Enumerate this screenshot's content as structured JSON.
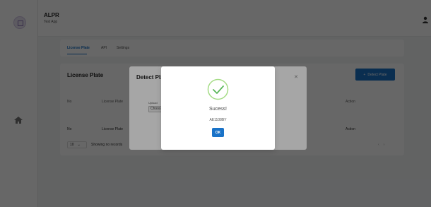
{
  "app": {
    "title": "ALPR",
    "subtitle": "Test App"
  },
  "tabs": [
    {
      "label": "License Plate",
      "active": true
    },
    {
      "label": "API",
      "active": false
    },
    {
      "label": "Settings",
      "active": false
    }
  ],
  "card": {
    "title": "License Plate",
    "detect_button": "Detect Plate",
    "headers": [
      "No",
      "License Plate",
      "Action"
    ],
    "footer": [
      "No",
      "License Plate",
      "Action"
    ],
    "page_size": "10",
    "records_text": "Showing no records"
  },
  "detect_modal": {
    "title": "Detect Plat",
    "upload_label": "Upload",
    "choose_button": "Choos"
  },
  "alert": {
    "title": "Sucess!",
    "plate": "AE1108BY",
    "ok_label": "OK"
  },
  "colors": {
    "primary": "#1a73c8",
    "success": "#5cb85c"
  },
  "icons": {
    "logo": "chip-logo-icon",
    "home": "home-icon",
    "user": "user-icon",
    "success": "check-circle-icon"
  }
}
